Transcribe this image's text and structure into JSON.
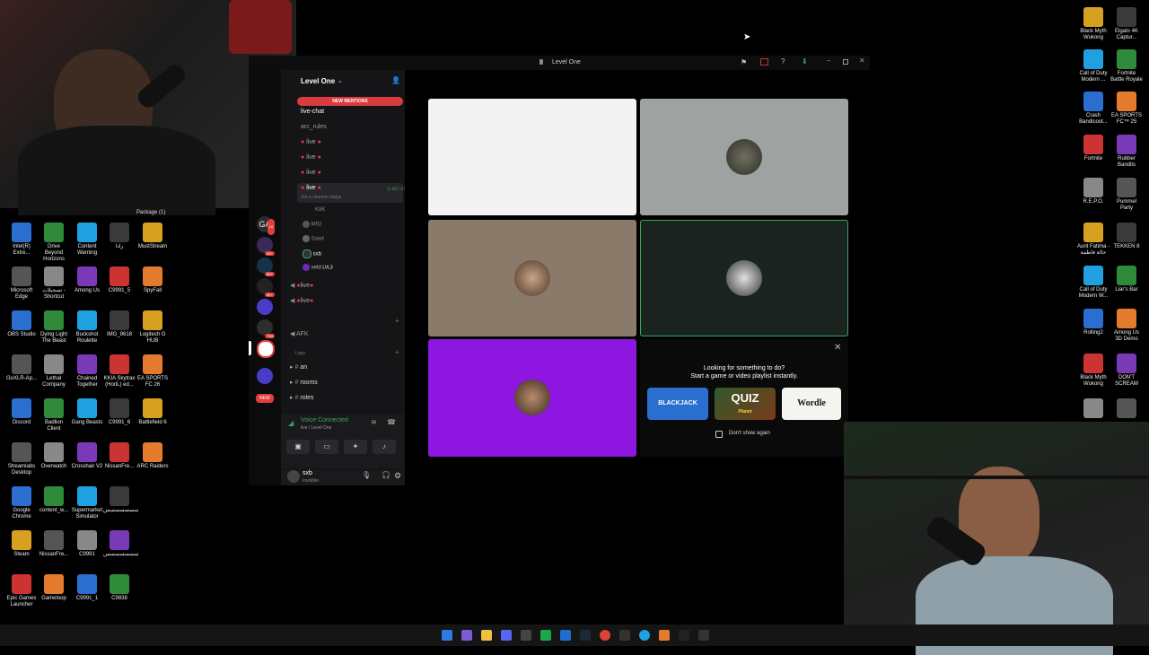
{
  "desktop_left": [
    {
      "label": "Intel(R) Extre..."
    },
    {
      "label": "Drive Beyond Horizons"
    },
    {
      "label": "Content Warning"
    },
    {
      "label": "رادا"
    },
    {
      "label": "MustStream"
    },
    {
      "label": "Microsoft Edge"
    },
    {
      "label": "تسجيلات - Shortcut"
    },
    {
      "label": "Among Us"
    },
    {
      "label": "C9991_5"
    },
    {
      "label": "SpyFall"
    },
    {
      "label": "OBS Studio"
    },
    {
      "label": "Dying Light The Beast"
    },
    {
      "label": "Buckshot Roulette"
    },
    {
      "label": "IMG_9618"
    },
    {
      "label": "Logitech G HUB"
    },
    {
      "label": "GoXLR-Ap..."
    },
    {
      "label": "Lethal Company"
    },
    {
      "label": "Chained Together"
    },
    {
      "label": "KKIA Skytrax (HoriL) ed..."
    },
    {
      "label": "EA SPORTS FC 26"
    },
    {
      "label": "Discord"
    },
    {
      "label": "Badlion Client"
    },
    {
      "label": "Gang Beasts"
    },
    {
      "label": "C9991_6"
    },
    {
      "label": "Battlefield 6"
    },
    {
      "label": "Streamlabs Desktop"
    },
    {
      "label": "Overwatch"
    },
    {
      "label": "Crosshair V2"
    },
    {
      "label": "NissanFre..."
    },
    {
      "label": "ARC Raiders"
    },
    {
      "label": "Google Chrome"
    },
    {
      "label": "content_w..."
    },
    {
      "label": "Supermarket Simulator"
    },
    {
      "label": "سسسسسسس"
    },
    {
      "label": "Steam"
    },
    {
      "label": "NissanFre..."
    },
    {
      "label": "C9991"
    },
    {
      "label": "سسسسسسس"
    },
    {
      "label": "Epic Games Launcher"
    },
    {
      "label": "Gameloop"
    },
    {
      "label": "C9991_1"
    },
    {
      "label": "C9838"
    }
  ],
  "package_label": "Package (1)",
  "desktop_right": [
    {
      "label": "Black Myth Wukong"
    },
    {
      "label": "Elgato 4K Captur..."
    },
    {
      "label": "Call of Duty Modern ..."
    },
    {
      "label": "Fortnite Battle Royale"
    },
    {
      "label": "Crash Bandicoot..."
    },
    {
      "label": "EA SPORTS FC™ 25"
    },
    {
      "label": "Fortnite"
    },
    {
      "label": "Rubber Bandits"
    },
    {
      "label": "R.E.P.O."
    },
    {
      "label": "Pummel Party"
    },
    {
      "label": "Aunt Fatima - خالة فاطمة"
    },
    {
      "label": "TEKKEN 8"
    },
    {
      "label": "Call of Duty Modern W..."
    },
    {
      "label": "Liar's Bar"
    },
    {
      "label": "Rolling2"
    },
    {
      "label": "Among Us 3D Demo"
    },
    {
      "label": "Black Myth Wukong"
    },
    {
      "label": "DON'T SCREAM"
    },
    {
      "label": ""
    },
    {
      "label": ""
    }
  ],
  "window": {
    "title": "Level One",
    "server_name": "Level One",
    "new_mentions": "NEW MENTIONS",
    "new_badge": "NEW",
    "server_badges": [
      "18",
      "1K+",
      "9K+",
      "4K+",
      "790"
    ],
    "channels": {
      "live_chat": "live-chat",
      "arc_rules": "arc_rules",
      "live1": "live",
      "live2": "live",
      "live3": "live",
      "live4": "live",
      "live4_time": "3:02:37",
      "set_status": "Set a channel status",
      "member1": "K8K",
      "member2": "M92",
      "member3": "Saad",
      "member4": "sxb",
      "member5": "xeld",
      "member5_tag": "LVL3",
      "live5": "live",
      "live6": "live",
      "afk": "AFK",
      "logs": "Logs",
      "an": "an",
      "rooms": "rooms",
      "roles": "roles"
    },
    "voice": {
      "status": "Voice Connected",
      "sub": "live / Level One"
    },
    "user": {
      "name": "sxb",
      "status": "Invisible"
    },
    "activity": {
      "title": "Looking for something to do?",
      "subtitle": "Start a game or video playlist instantly.",
      "games": [
        "BLACKJACK",
        "QUIZ",
        "Wordle"
      ],
      "quiz_sub": "Planet",
      "checkbox": "Don't show again"
    }
  },
  "colors": {
    "accent": "#e23c3c",
    "purple": "#8d16e0",
    "voice_green": "#3ba55c",
    "wordle_bg": "#f5f5f0"
  }
}
